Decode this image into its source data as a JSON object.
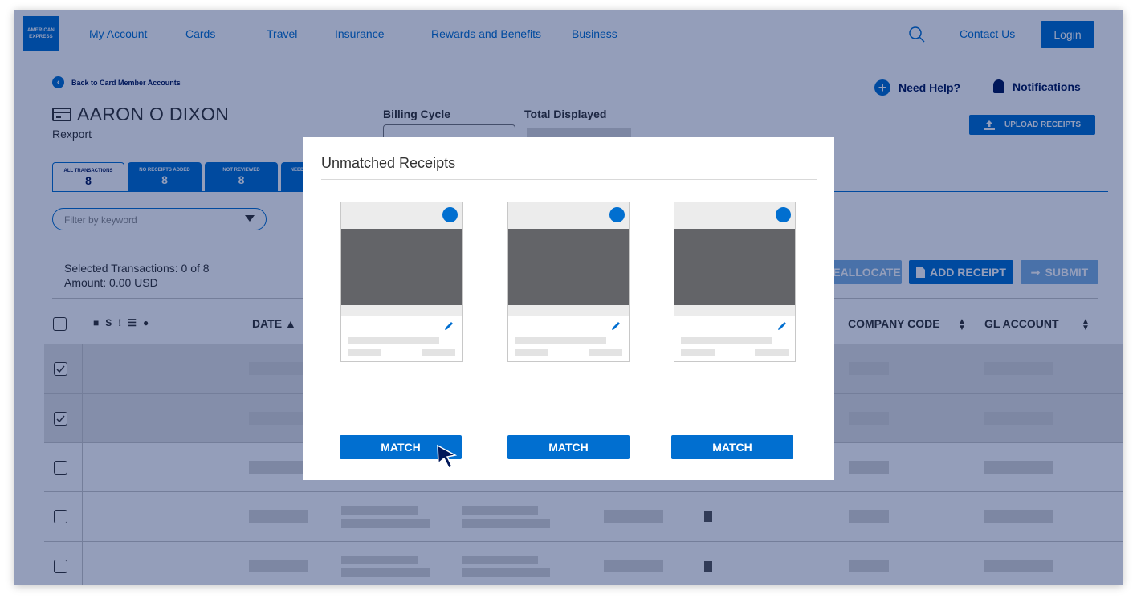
{
  "nav": {
    "logo_text": "AMERICAN EXPRESS",
    "items": [
      "My Account",
      "Cards",
      "Travel",
      "Insurance",
      "Rewards and Benefits",
      "Business"
    ],
    "contact": "Contact Us",
    "login": "Login",
    "search_icon": "search-icon"
  },
  "page": {
    "back_link": "Back to Card Member Accounts",
    "holder_name": "AARON O DIXON",
    "holder_sub": "Rexport",
    "billing_cycle_label": "Billing Cycle",
    "total_displayed_label": "Total Displayed",
    "need_help": "Need Help?",
    "notifications": "Notifications",
    "upload_receipts": "UPLOAD RECEIPTS",
    "tabs": [
      {
        "label": "ALL TRANSACTIONS",
        "count": "8"
      },
      {
        "label": "NO RECEIPTS ADDED",
        "count": "8"
      },
      {
        "label": "NOT REVIEWED",
        "count": "8"
      },
      {
        "label": "NEED",
        "count": ""
      }
    ],
    "filter_placeholder": "Filter by keyword",
    "selected_transactions": "Selected Transactions: 0 of 8",
    "amount": "Amount: 0.00 USD",
    "actions": {
      "reallocate": "EALLOCATE",
      "add_receipt": "ADD RECEIPT",
      "submit": "SUBMIT"
    },
    "header_icons": [
      "lock-icon",
      "S",
      "!",
      "list-icon",
      "comment-icon"
    ],
    "columns": {
      "date": "DATE",
      "company_code": "COMPANY CODE",
      "gl_account": "GL ACCOUNT"
    },
    "rows": [
      {
        "selected": true
      },
      {
        "selected": true
      },
      {
        "selected": false
      },
      {
        "selected": false
      },
      {
        "selected": false
      }
    ]
  },
  "modal": {
    "title": "Unmatched Receipts",
    "receipts": [
      {
        "match_label": "MATCH"
      },
      {
        "match_label": "MATCH"
      },
      {
        "match_label": "MATCH"
      }
    ]
  },
  "colors": {
    "brand_blue": "#016fd0",
    "navy": "#00175a",
    "overlay": "rgba(0,23,90,0.42)"
  }
}
